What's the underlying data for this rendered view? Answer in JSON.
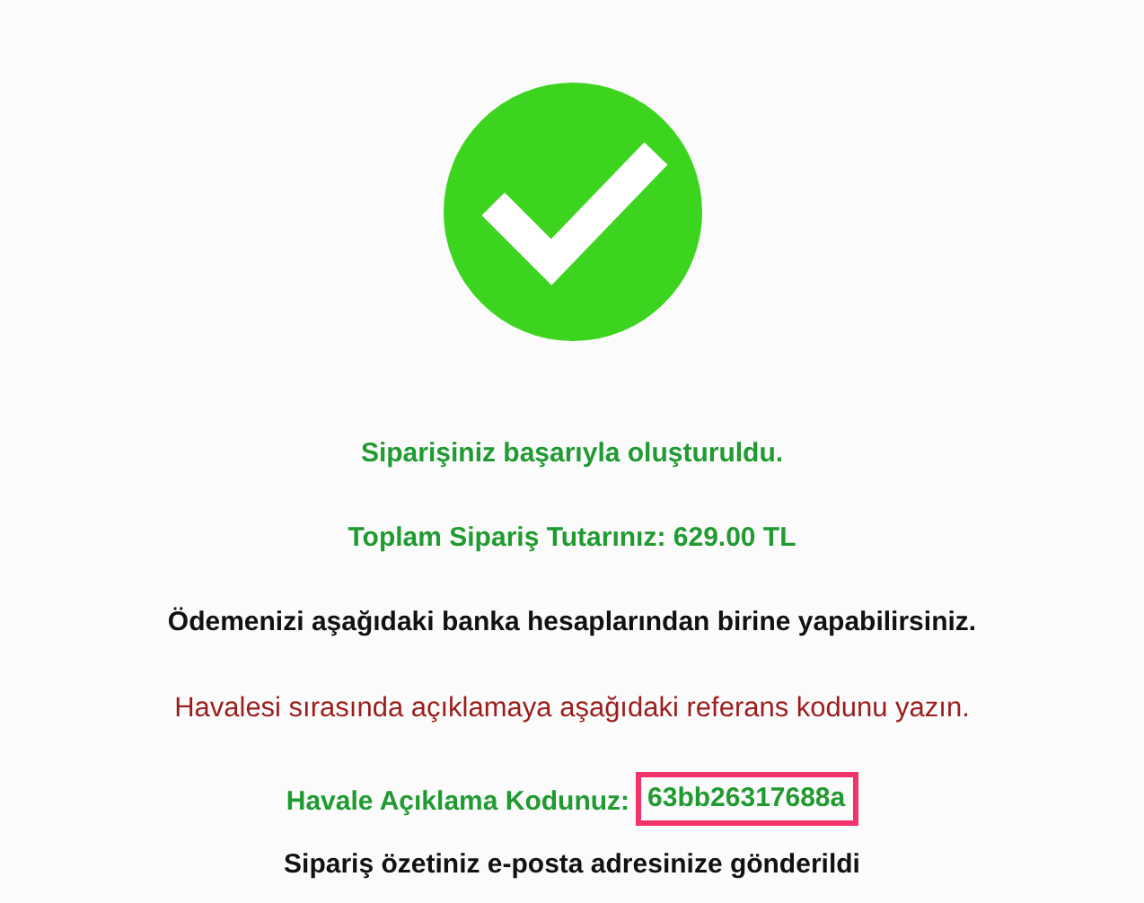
{
  "messages": [
    {
      "kind": "success",
      "text": "Siparişiniz başarıyla oluşturuldu."
    },
    {
      "kind": "success",
      "text": "Toplam Sipariş Tutarınız: 629.00 TL"
    },
    {
      "kind": "info",
      "text": "Ödemenizi aşağıdaki banka hesaplarından birine yapabilirsiniz."
    },
    {
      "kind": "warning",
      "text": "Havalesi sırasında açıklamaya aşağıdaki referans kodunu yazın."
    },
    {
      "kind": "reference",
      "label": "Havale Açıklama Kodunuz:",
      "code": "63bb26317688a",
      "highlighted": true
    },
    {
      "kind": "info",
      "text": "Sipariş özetiniz e-posta adresinize gönderildi"
    }
  ]
}
